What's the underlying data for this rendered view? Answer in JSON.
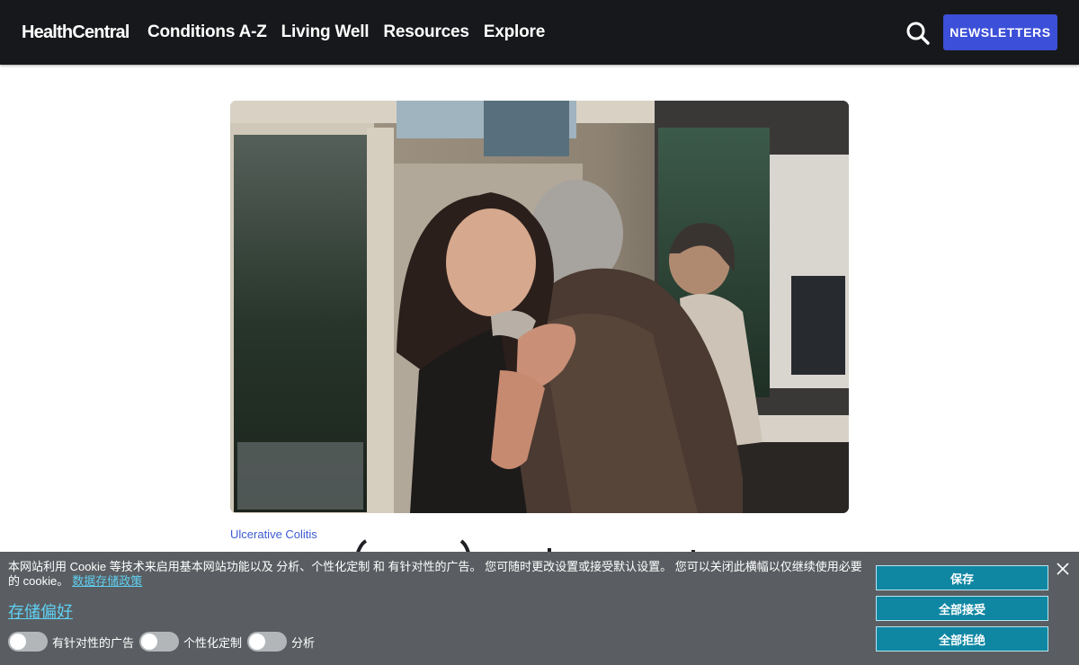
{
  "header": {
    "logo": "HealthCentral",
    "nav": [
      "Conditions A-Z",
      "Living Well",
      "Resources",
      "Explore"
    ],
    "search_icon": "search-icon",
    "newsletter_label": "NEWSLETTERS"
  },
  "article": {
    "category": "Ulcerative Colitis"
  },
  "cookie_banner": {
    "text": "本网站利用 Cookie 等技术来启用基本网站功能以及 分析、个性化定制 和 有针对性的广告。 您可随时更改设置或接受默认设置。 您可以关闭此横幅以仅继续使用必要的 cookie。",
    "policy_link": "数据存储政策",
    "preferences_link": "存储偏好",
    "toggles": [
      {
        "label": "有针对性的广告",
        "on": false
      },
      {
        "label": "个性化定制",
        "on": false
      },
      {
        "label": "分析",
        "on": false
      }
    ],
    "save_label": "保存",
    "accept_all_label": "全部接受",
    "reject_all_label": "全部拒绝",
    "close_icon": "close-icon"
  },
  "colors": {
    "header_bg": "#17181b",
    "newsletter_bg": "#3c4fd8",
    "category_link": "#3c5bd4",
    "banner_bg": "#5a5e62",
    "banner_button": "#0f87a3",
    "banner_link": "#5fd0f2"
  }
}
